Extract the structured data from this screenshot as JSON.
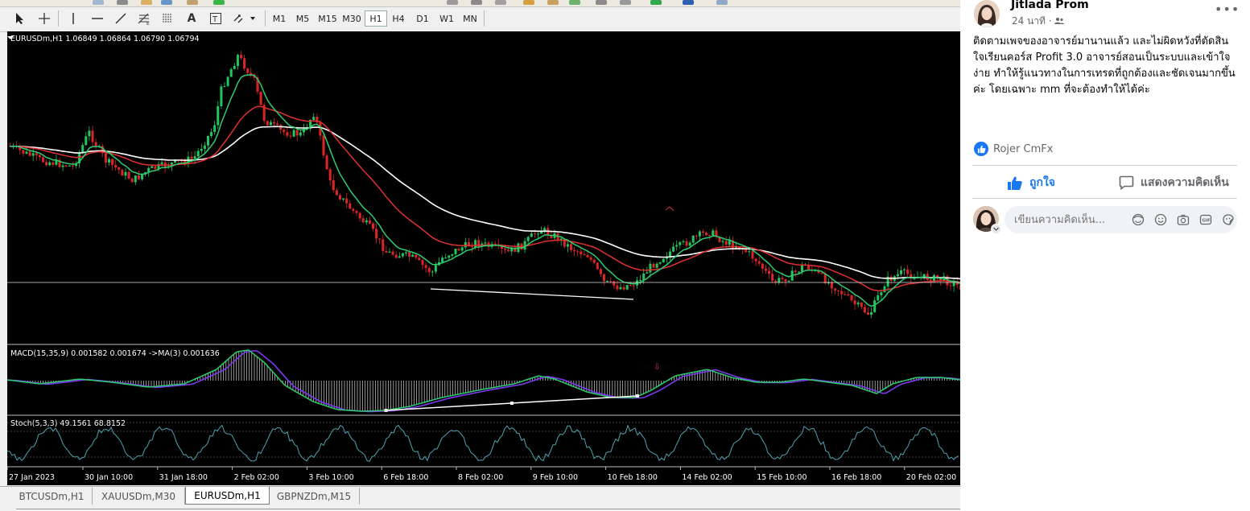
{
  "terminal": {
    "timeframes": [
      "M1",
      "M5",
      "M15",
      "M30",
      "H1",
      "H4",
      "D1",
      "W1",
      "MN"
    ],
    "active_timeframe": "H1",
    "tools": [
      "cursor-icon",
      "crosshair-icon",
      "vertical-line-icon",
      "horizontal-line-icon",
      "trendline-icon",
      "fibonacci-icon",
      "text-icon",
      "text-label-icon",
      "arrows-icon"
    ],
    "chart": {
      "symbol_header": "EURUSDm,H1  1.06849 1.06864 1.06790 1.06794",
      "macd_header": "MACD(15,35,9) 0.001582 0.001674  ->MA(3) 0.001636",
      "stoch_header": "Stoch(5,3,3) 49.1561 68.8152",
      "time_labels": [
        "27 Jan 2023",
        "30 Jan 10:00",
        "31 Jan 18:00",
        "2 Feb 02:00",
        "3 Feb 10:00",
        "6 Feb 18:00",
        "8 Feb 02:00",
        "9 Feb 10:00",
        "10 Feb 18:00",
        "14 Feb 02:00",
        "15 Feb 10:00",
        "16 Feb 18:00",
        "20 Feb 02:00"
      ],
      "colors": {
        "background": "#000000",
        "bull": "#22c55e",
        "bear": "#dc2626",
        "ma_fast": "#2ecc71",
        "ma_mid": "#e03131",
        "ma_slow": "#ffffff",
        "macd_signal": "#7c3aed",
        "stoch": "#4fa3b0"
      }
    },
    "tabs": [
      "BTCUSDm,H1",
      "XAUUSDm,M30",
      "EURUSDm,H1",
      "GBPNZDm,M15"
    ],
    "active_tab": "EURUSDm,H1"
  },
  "facebook": {
    "author": "Jitlada Prom",
    "time": "24 นาที ·",
    "post_text": "ติดตามเพจของอาจารย์มานานแล้ว และไม่ผิดหวังที่ตัดสินใจเรียนคอร์ส Profit 3.0 อาจารย์สอนเป็นระบบและเข้าใจง่าย ทำให้รู้แนวทางในการเทรดที่ถูกต้องและชัดเจนมากขึ้นค่ะ โดยเฉพาะ mm ที่จะต้องทำให้ได้ค่ะ",
    "reactor": "Rojer CmFx",
    "like_label": "ถูกใจ",
    "comment_label": "แสดงความคิดเห็น",
    "comment_placeholder": "เขียนความคิดเห็น..."
  }
}
